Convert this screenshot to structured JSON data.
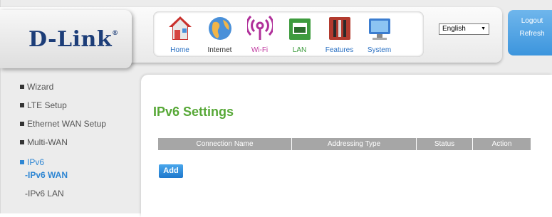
{
  "logo": {
    "text": "D-Link",
    "mark": "®"
  },
  "nav": {
    "items": [
      {
        "label": "Home",
        "icon": "home-icon"
      },
      {
        "label": "Internet",
        "icon": "globe-icon"
      },
      {
        "label": "Wi-Fi",
        "icon": "wifi-icon"
      },
      {
        "label": "LAN",
        "icon": "lan-icon"
      },
      {
        "label": "Features",
        "icon": "tools-icon"
      },
      {
        "label": "System",
        "icon": "monitor-icon"
      }
    ]
  },
  "language": {
    "selected": "English"
  },
  "account": {
    "logout": "Logout",
    "refresh": "Refresh"
  },
  "sidebar": {
    "items": [
      {
        "label": "Wizard"
      },
      {
        "label": "LTE Setup"
      },
      {
        "label": "Ethernet WAN Setup"
      },
      {
        "label": "Multi-WAN"
      },
      {
        "label": "IPv6"
      }
    ],
    "subitems": [
      {
        "label": "-IPv6 WAN"
      },
      {
        "label": "-IPv6 LAN"
      }
    ]
  },
  "main": {
    "title": "IPv6 Settings",
    "table": {
      "columns": [
        "Connection Name",
        "Addressing Type",
        "Status",
        "Action"
      ]
    },
    "add_label": "Add"
  },
  "colors": {
    "accent_blue": "#2e86d3",
    "title_green": "#57a837",
    "logo_navy": "#1c3d78",
    "table_header": "#a6a6a6"
  }
}
